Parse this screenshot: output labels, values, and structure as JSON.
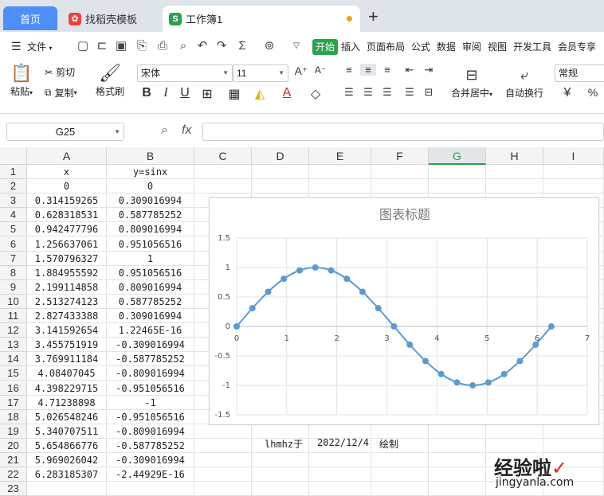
{
  "tabs": {
    "home": "首页",
    "template": "找稻壳模板",
    "workbook": "工作簿1",
    "add": "+"
  },
  "menu": {
    "file": "文件",
    "start": "开始",
    "items": [
      "插入",
      "页面布局",
      "公式",
      "数据",
      "审阅",
      "视图",
      "开发工具",
      "会员专享"
    ]
  },
  "ribbon": {
    "paste": "粘贴",
    "cut": "剪切",
    "copy": "复制",
    "format_painter": "格式刷",
    "font_name": "宋体",
    "font_size": "11",
    "merge_center": "合并居中",
    "wrap_text": "自动换行",
    "number_format": "常规",
    "bold": "B",
    "italic": "I",
    "underline": "U",
    "font_grow": "A⁺",
    "font_shrink": "A⁻",
    "currency": "¥",
    "percent": "%"
  },
  "formula": {
    "cell_ref": "G25",
    "fx": "fx",
    "value": ""
  },
  "columns": [
    "A",
    "B",
    "C",
    "D",
    "E",
    "F",
    "G",
    "H",
    "I"
  ],
  "rows": [
    [
      "x",
      "y=sinx"
    ],
    [
      "0",
      "0"
    ],
    [
      "0.314159265",
      "0.309016994"
    ],
    [
      "0.628318531",
      "0.587785252"
    ],
    [
      "0.942477796",
      "0.809016994"
    ],
    [
      "1.256637061",
      "0.951056516"
    ],
    [
      "1.570796327",
      "1"
    ],
    [
      "1.884955592",
      "0.951056516"
    ],
    [
      "2.199114858",
      "0.809016994"
    ],
    [
      "2.513274123",
      "0.587785252"
    ],
    [
      "2.827433388",
      "0.309016994"
    ],
    [
      "3.141592654",
      "1.22465E-16"
    ],
    [
      "3.455751919",
      "-0.309016994"
    ],
    [
      "3.769911184",
      "-0.587785252"
    ],
    [
      "4.08407045",
      "-0.809016994"
    ],
    [
      "4.398229715",
      "-0.951056516"
    ],
    [
      "4.71238898",
      "-1"
    ],
    [
      "5.026548246",
      "-0.951056516"
    ],
    [
      "5.340707511",
      "-0.809016994"
    ],
    [
      "5.654866776",
      "-0.587785252"
    ],
    [
      "5.969026042",
      "-0.309016994"
    ],
    [
      "6.283185307",
      "-2.44929E-16"
    ]
  ],
  "note": {
    "author": "lhmhz于",
    "date": "2022/12/4",
    "action": "绘制"
  },
  "watermark": {
    "line1": "经验啦",
    "check": "✓",
    "line2": "jingyanla.com"
  },
  "colors": {
    "accent": "#22a04a",
    "series": "#5b9bd5",
    "home_tab": "#4d8ef7"
  },
  "chart_data": {
    "type": "line",
    "title": "图表标题",
    "x": [
      0,
      0.314159265,
      0.628318531,
      0.942477796,
      1.256637061,
      1.570796327,
      1.884955592,
      2.199114858,
      2.513274123,
      2.827433388,
      3.141592654,
      3.455751919,
      3.769911184,
      4.08407045,
      4.398229715,
      4.71238898,
      5.026548246,
      5.340707511,
      5.654866776,
      5.969026042,
      6.283185307
    ],
    "series": [
      {
        "values": [
          0,
          0.309016994,
          0.587785252,
          0.809016994,
          0.951056516,
          1,
          0.951056516,
          0.809016994,
          0.587785252,
          0.309016994,
          0,
          -0.309016994,
          -0.587785252,
          -0.809016994,
          -0.951056516,
          -1,
          -0.951056516,
          -0.809016994,
          -0.587785252,
          -0.309016994,
          0
        ]
      }
    ],
    "xlim": [
      0,
      7
    ],
    "ylim": [
      -1.5,
      1.5
    ],
    "xticks": [
      "0",
      "1",
      "2",
      "3",
      "4",
      "5",
      "6",
      "7"
    ],
    "yticks": [
      "1.5",
      "1",
      "0.5",
      "0",
      "-0.5",
      "-1",
      "-1.5"
    ],
    "grid": true,
    "legend": "none"
  }
}
